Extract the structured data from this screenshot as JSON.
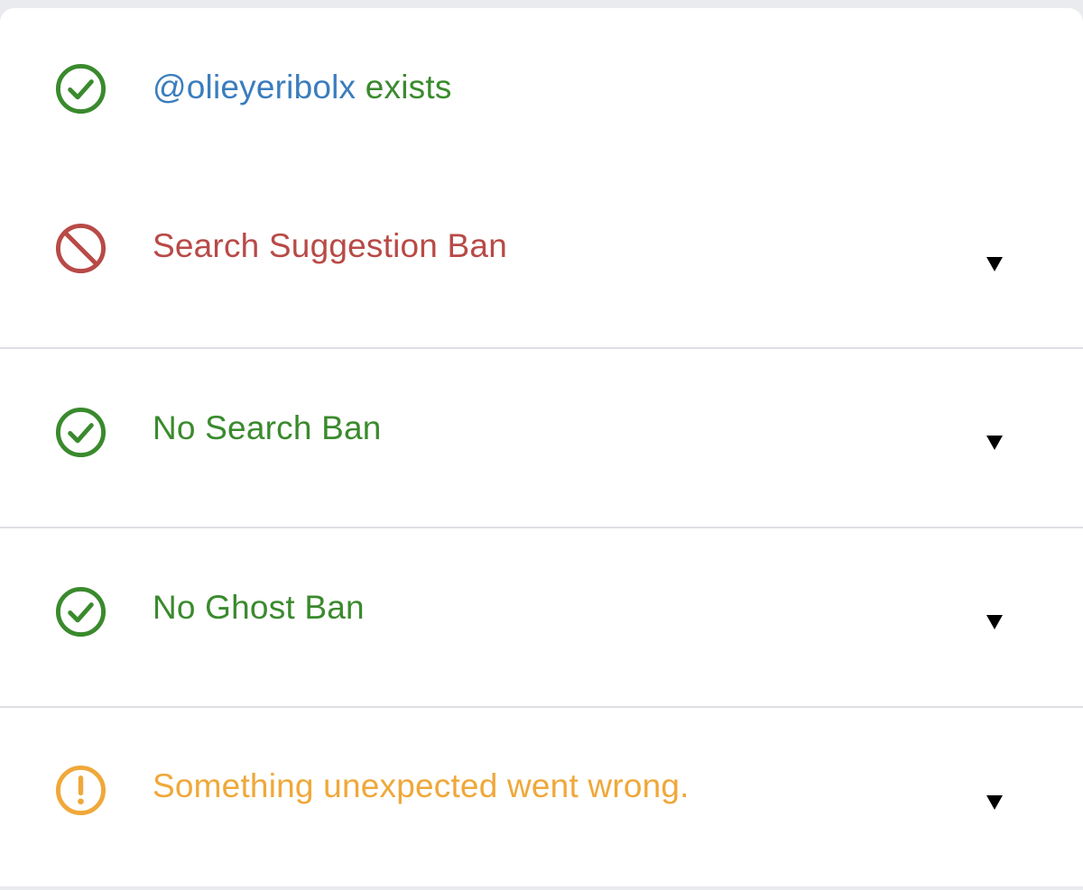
{
  "colors": {
    "ok": "#3a8a2d",
    "ban": "#b84a47",
    "warn": "#efa83a",
    "handle": "#3a7dbd"
  },
  "results": {
    "exists": {
      "icon": "check-circle-icon",
      "handle": "@olieyeribolx",
      "suffix": " exists"
    },
    "search_suggestion_ban": {
      "icon": "prohibited-icon",
      "label": "Search Suggestion Ban"
    },
    "search_ban": {
      "icon": "check-circle-icon",
      "label": "No Search Ban"
    },
    "ghost_ban": {
      "icon": "check-circle-icon",
      "label": "No Ghost Ban"
    },
    "reply_deboosting": {
      "icon": "exclamation-circle-icon",
      "label": "Something unexpected went wrong."
    }
  }
}
